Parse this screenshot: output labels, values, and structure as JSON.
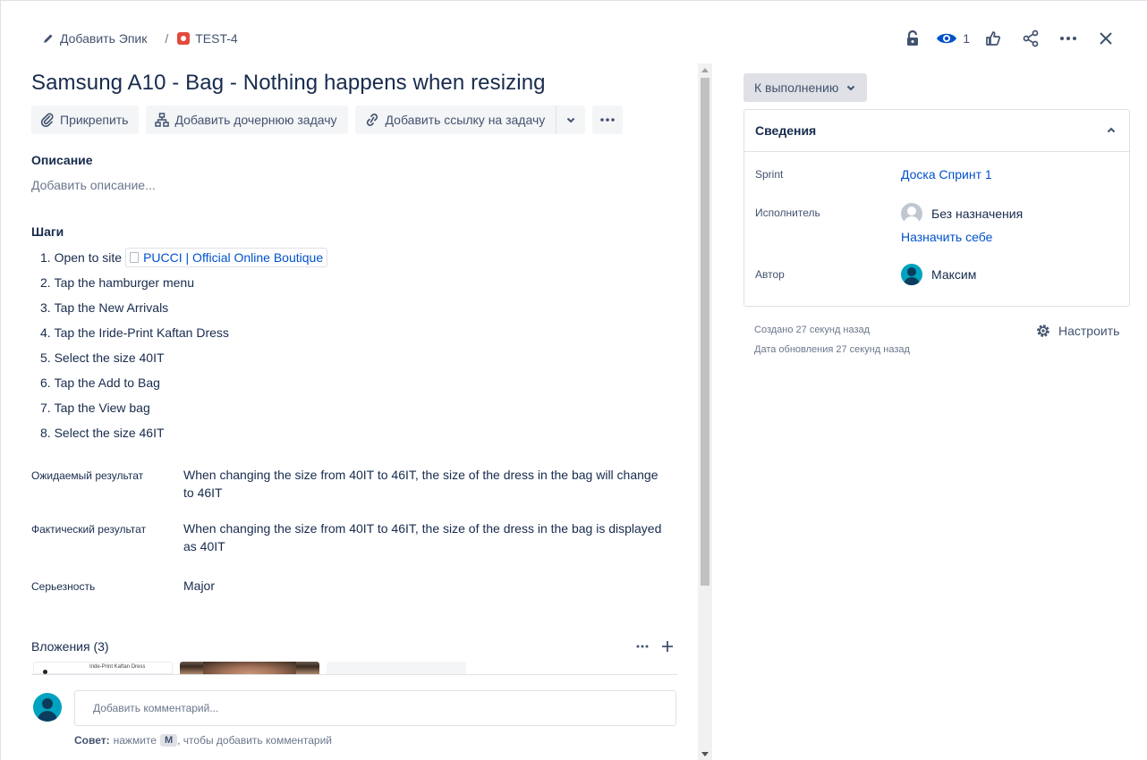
{
  "header": {
    "add_epic_label": "Добавить Эпик",
    "separator": "/",
    "issue_key": "TEST-4",
    "watchers_count": "1"
  },
  "issue": {
    "title": "Samsung A10 - Bag - Nothing happens when resizing",
    "actions": {
      "attach": "Прикрепить",
      "add_child": "Добавить дочернюю задачу",
      "add_link": "Добавить ссылку на задачу"
    },
    "description": {
      "label": "Описание",
      "placeholder": "Добавить описание..."
    },
    "steps": {
      "label": "Шаги",
      "items": [
        {
          "num": "1.",
          "text": "Open to site",
          "link": "PUCCI | Official Online Boutique"
        },
        {
          "num": "2.",
          "text": "Tap the hamburger menu"
        },
        {
          "num": "3.",
          "text": "Tap the New Arrivals"
        },
        {
          "num": "4.",
          "text": "Tap the Iride-Print Kaftan Dress"
        },
        {
          "num": "5.",
          "text": "Select the size 40IT"
        },
        {
          "num": "6.",
          "text": "Tap the Add to Bag"
        },
        {
          "num": "7.",
          "text": "Tap the View bag"
        },
        {
          "num": "8.",
          "text": "Select the size 46IT"
        }
      ]
    },
    "fields": {
      "expected_label": "Ожидаемый результат",
      "expected_value": "When changing the size from 40IT to 46IT, the size of the dress in the bag will change to 46IT",
      "actual_label": "Фактический результат",
      "actual_value": "When changing the size from 40IT to 46IT, the size of the dress in the bag is displayed as 40IT",
      "severity_label": "Серьезность",
      "severity_value": "Major"
    },
    "attachments": {
      "label": "Вложения (3)",
      "thumb1_caption": "Iride-Print Kaftan Dress"
    },
    "comment": {
      "placeholder": "Добавить комментарий...",
      "tip_prefix": "Совет:",
      "tip_text1": "нажмите",
      "tip_key": "M",
      "tip_text2": ", чтобы добавить комментарий"
    }
  },
  "sidebar": {
    "status": "К выполнению",
    "details_title": "Сведения",
    "sprint_label": "Sprint",
    "sprint_value": "Доска Спринт 1",
    "assignee_label": "Исполнитель",
    "assignee_value": "Без назначения",
    "assign_to_me": "Назначить себе",
    "reporter_label": "Автор",
    "reporter_value": "Максим",
    "created": "Создано 27 секунд назад",
    "updated": "Дата обновления 27 секунд назад",
    "configure": "Настроить"
  },
  "colors": {
    "link": "#0052cc",
    "bug": "#e5493a",
    "avatar": "#00a3bf"
  }
}
